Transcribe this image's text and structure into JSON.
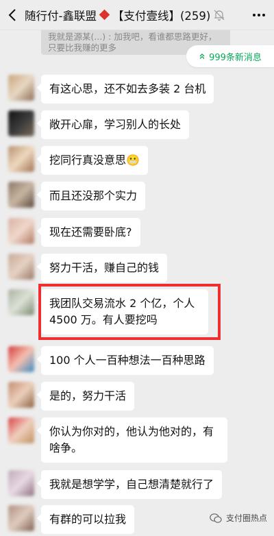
{
  "header": {
    "title_left": "随行付-鑫联盟",
    "title_right": "【支付壹线】(259)"
  },
  "pinned": {
    "text": "我就是源某(...) : 加我吧，看谁都思路更好，只要比我赚的更多"
  },
  "new_messages": {
    "label": "999条新消息"
  },
  "messages": [
    {
      "text": "有这心思，还不如去多装 2 台机"
    },
    {
      "text": "敞开心扉，学习别人的长处"
    },
    {
      "text": "挖同行真没意思😬"
    },
    {
      "text": "而且还没那个实力"
    },
    {
      "text": "现在还需要卧底?"
    },
    {
      "text": "努力干活，赚自己的钱"
    },
    {
      "text": "我团队交易流水 2 个亿，个人 4500 万。有人要挖吗"
    },
    {
      "text": "100 个人一百种想法一百种思路"
    },
    {
      "text": "是的，努力干活"
    },
    {
      "text": "你认为你对的，他认为他对的，有啥争。"
    },
    {
      "text": "我就是想学学，自己想清楚就行了"
    },
    {
      "text": "有群的可以拉我"
    }
  ],
  "watermark": {
    "text": "支付圈热点"
  },
  "colors": {
    "background": "#ededed",
    "bubble": "#ffffff",
    "highlight_border": "#ef2f2f",
    "new_message_green": "#07a85a"
  }
}
